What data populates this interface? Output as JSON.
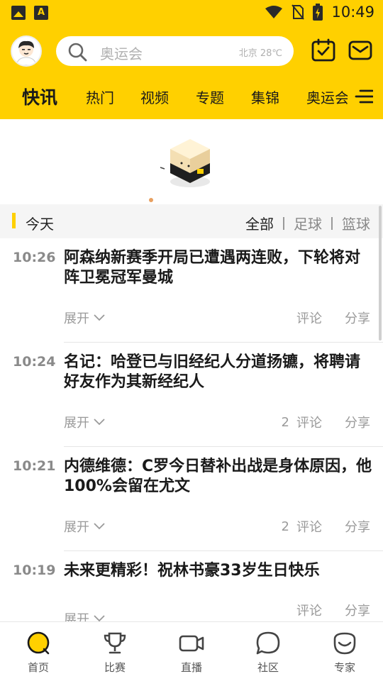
{
  "status_bar": {
    "time": "10:49",
    "left_icons": [
      "image-icon",
      "a-app-icon"
    ],
    "right_icons": [
      "wifi-icon",
      "no-sim-icon",
      "battery-charging-icon"
    ]
  },
  "header": {
    "search_placeholder": "奥运会",
    "weather": "北京  28℃",
    "icons": [
      "avatar",
      "search-icon",
      "calendar-check-icon",
      "mail-icon"
    ],
    "accent_color": "#FFD000"
  },
  "tabs": {
    "items": [
      "快讯",
      "热门",
      "视频",
      "专题",
      "集锦",
      "奥运会"
    ],
    "active": "快讯"
  },
  "filter_bar": {
    "today": "今天",
    "filters": [
      "全部",
      "足球",
      "篮球"
    ],
    "active": "全部"
  },
  "news": [
    {
      "time": "10:26",
      "title": "阿森纳新赛季开局已遭遇两连败，下轮将对阵卫冕冠军曼城",
      "expand": "展开",
      "comment_count": "",
      "comment": "评论",
      "share": "分享"
    },
    {
      "time": "10:24",
      "title": "名记：哈登已与旧经纪人分道扬镳，将聘请好友作为其新经纪人",
      "expand": "展开",
      "comment_count": "2",
      "comment": "评论",
      "share": "分享"
    },
    {
      "time": "10:21",
      "title": "内德维德：C罗今日替补出战是身体原因，他100%会留在尤文",
      "expand": "展开",
      "comment_count": "2",
      "comment": "评论",
      "share": "分享"
    },
    {
      "time": "10:19",
      "title": "未来更精彩！祝林书豪33岁生日快乐",
      "expand": "展开",
      "comment_count": "",
      "comment": "评论",
      "share": "分享"
    }
  ],
  "bottom_nav": [
    {
      "label": "首页",
      "icon": "home-icon"
    },
    {
      "label": "比赛",
      "icon": "trophy-icon"
    },
    {
      "label": "直播",
      "icon": "video-icon"
    },
    {
      "label": "社区",
      "icon": "chat-bubble-icon"
    },
    {
      "label": "专家",
      "icon": "expert-icon"
    }
  ]
}
